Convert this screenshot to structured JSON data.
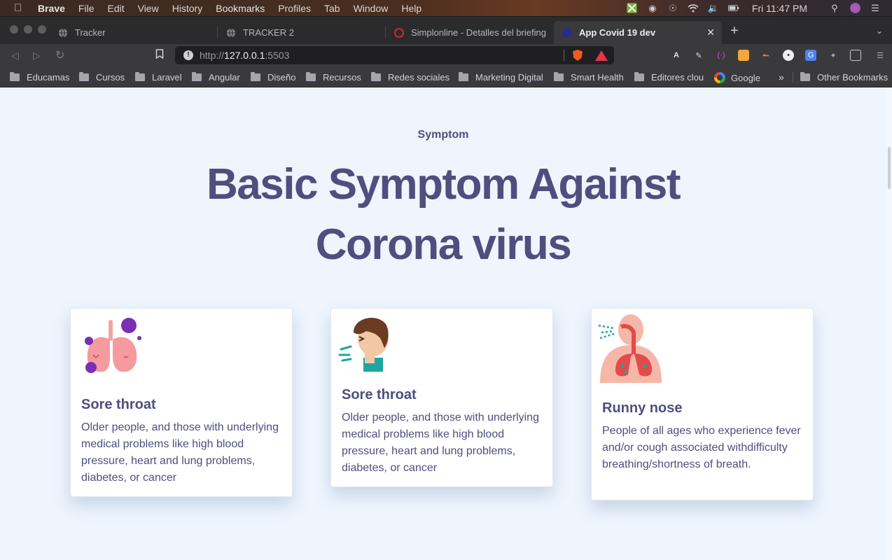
{
  "menubar": {
    "items": [
      "Brave",
      "File",
      "Edit",
      "View",
      "History",
      "Bookmarks",
      "Profiles",
      "Tab",
      "Window",
      "Help"
    ],
    "clock": "Fri 11:47 PM"
  },
  "tabs": [
    {
      "title": "Tracker"
    },
    {
      "title": "TRACKER 2"
    },
    {
      "title": "Simplonline - Detalles del briefing"
    },
    {
      "title": "App Covid 19 dev"
    }
  ],
  "toolbar": {
    "url_prefix": "http://",
    "url_host": "127.0.0.1",
    "url_port": ":5503"
  },
  "bookmarks": [
    "Educamas",
    "Cursos",
    "Laravel",
    "Angular",
    "Diseño",
    "Recursos",
    "Redes sociales",
    "Marketing Digital",
    "Smart Health",
    "Editores clou",
    "Google"
  ],
  "other_bookmarks": "Other Bookmarks",
  "section": {
    "eyebrow": "Symptom",
    "headline_line1": "Basic Symptom Against",
    "headline_line2": "Corona virus"
  },
  "cards": [
    {
      "title": "Sore throat",
      "description": "Older people, and those with underlying medical problems like high blood pressure, heart and lung problems, diabetes, or cancer",
      "icon": "lungs-virus-icon"
    },
    {
      "title": "Sore throat",
      "description": "Older people, and those with underlying medical problems like high blood pressure, heart and lung problems, diabetes, or cancer",
      "icon": "coughing-person-icon"
    },
    {
      "title": "Runny nose",
      "description": "People of all ages who experience fever and/or cough associated withdifficulty breathing/shortness of breath.",
      "icon": "respiratory-system-icon"
    }
  ]
}
